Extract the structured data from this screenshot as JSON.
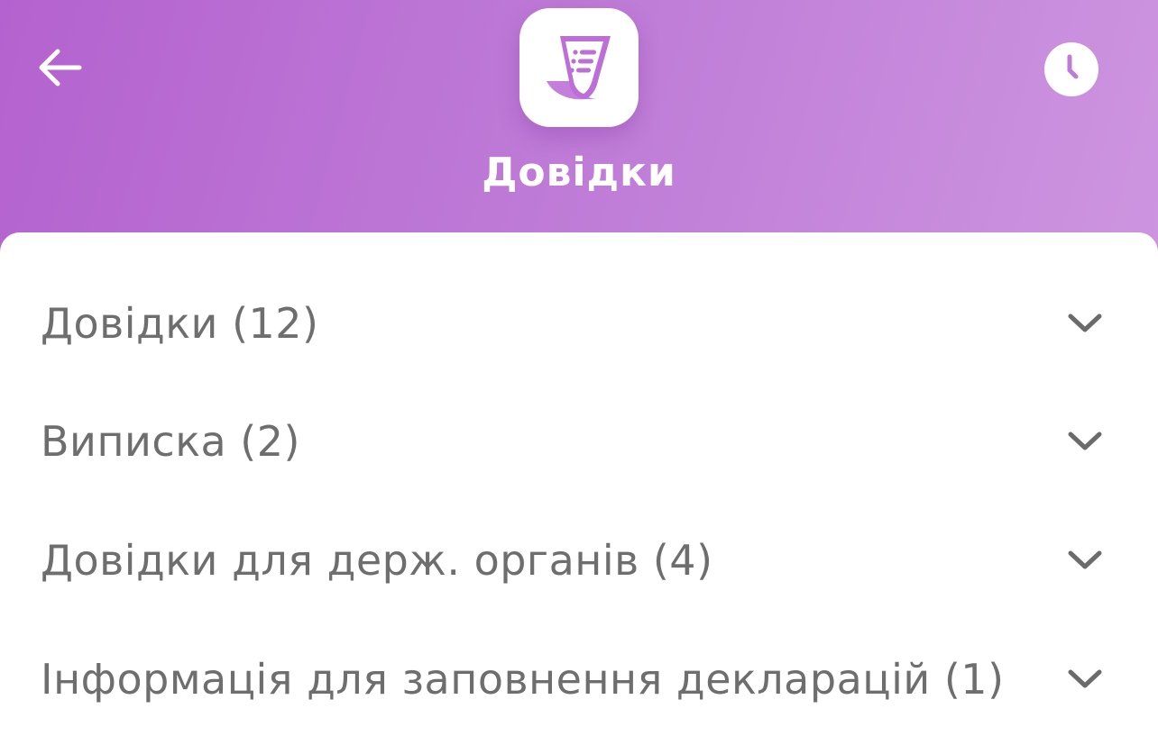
{
  "header": {
    "title": "Довідки",
    "back_icon": "arrow-left-icon",
    "history_icon": "clock-icon",
    "app_icon": "document-scroll-icon",
    "gradient_start": "#b462cf",
    "gradient_end": "#cd95e0",
    "app_icon_color": "#bc6fd6"
  },
  "list": {
    "text_color": "#6e6e6e",
    "chevron_color": "#6b6b6b",
    "items": [
      {
        "label": "Довідки (12)"
      },
      {
        "label": "Виписка (2)"
      },
      {
        "label": "Довідки для держ. органів (4)"
      },
      {
        "label": "Інформація для заповнення декларацій (1)"
      }
    ]
  }
}
